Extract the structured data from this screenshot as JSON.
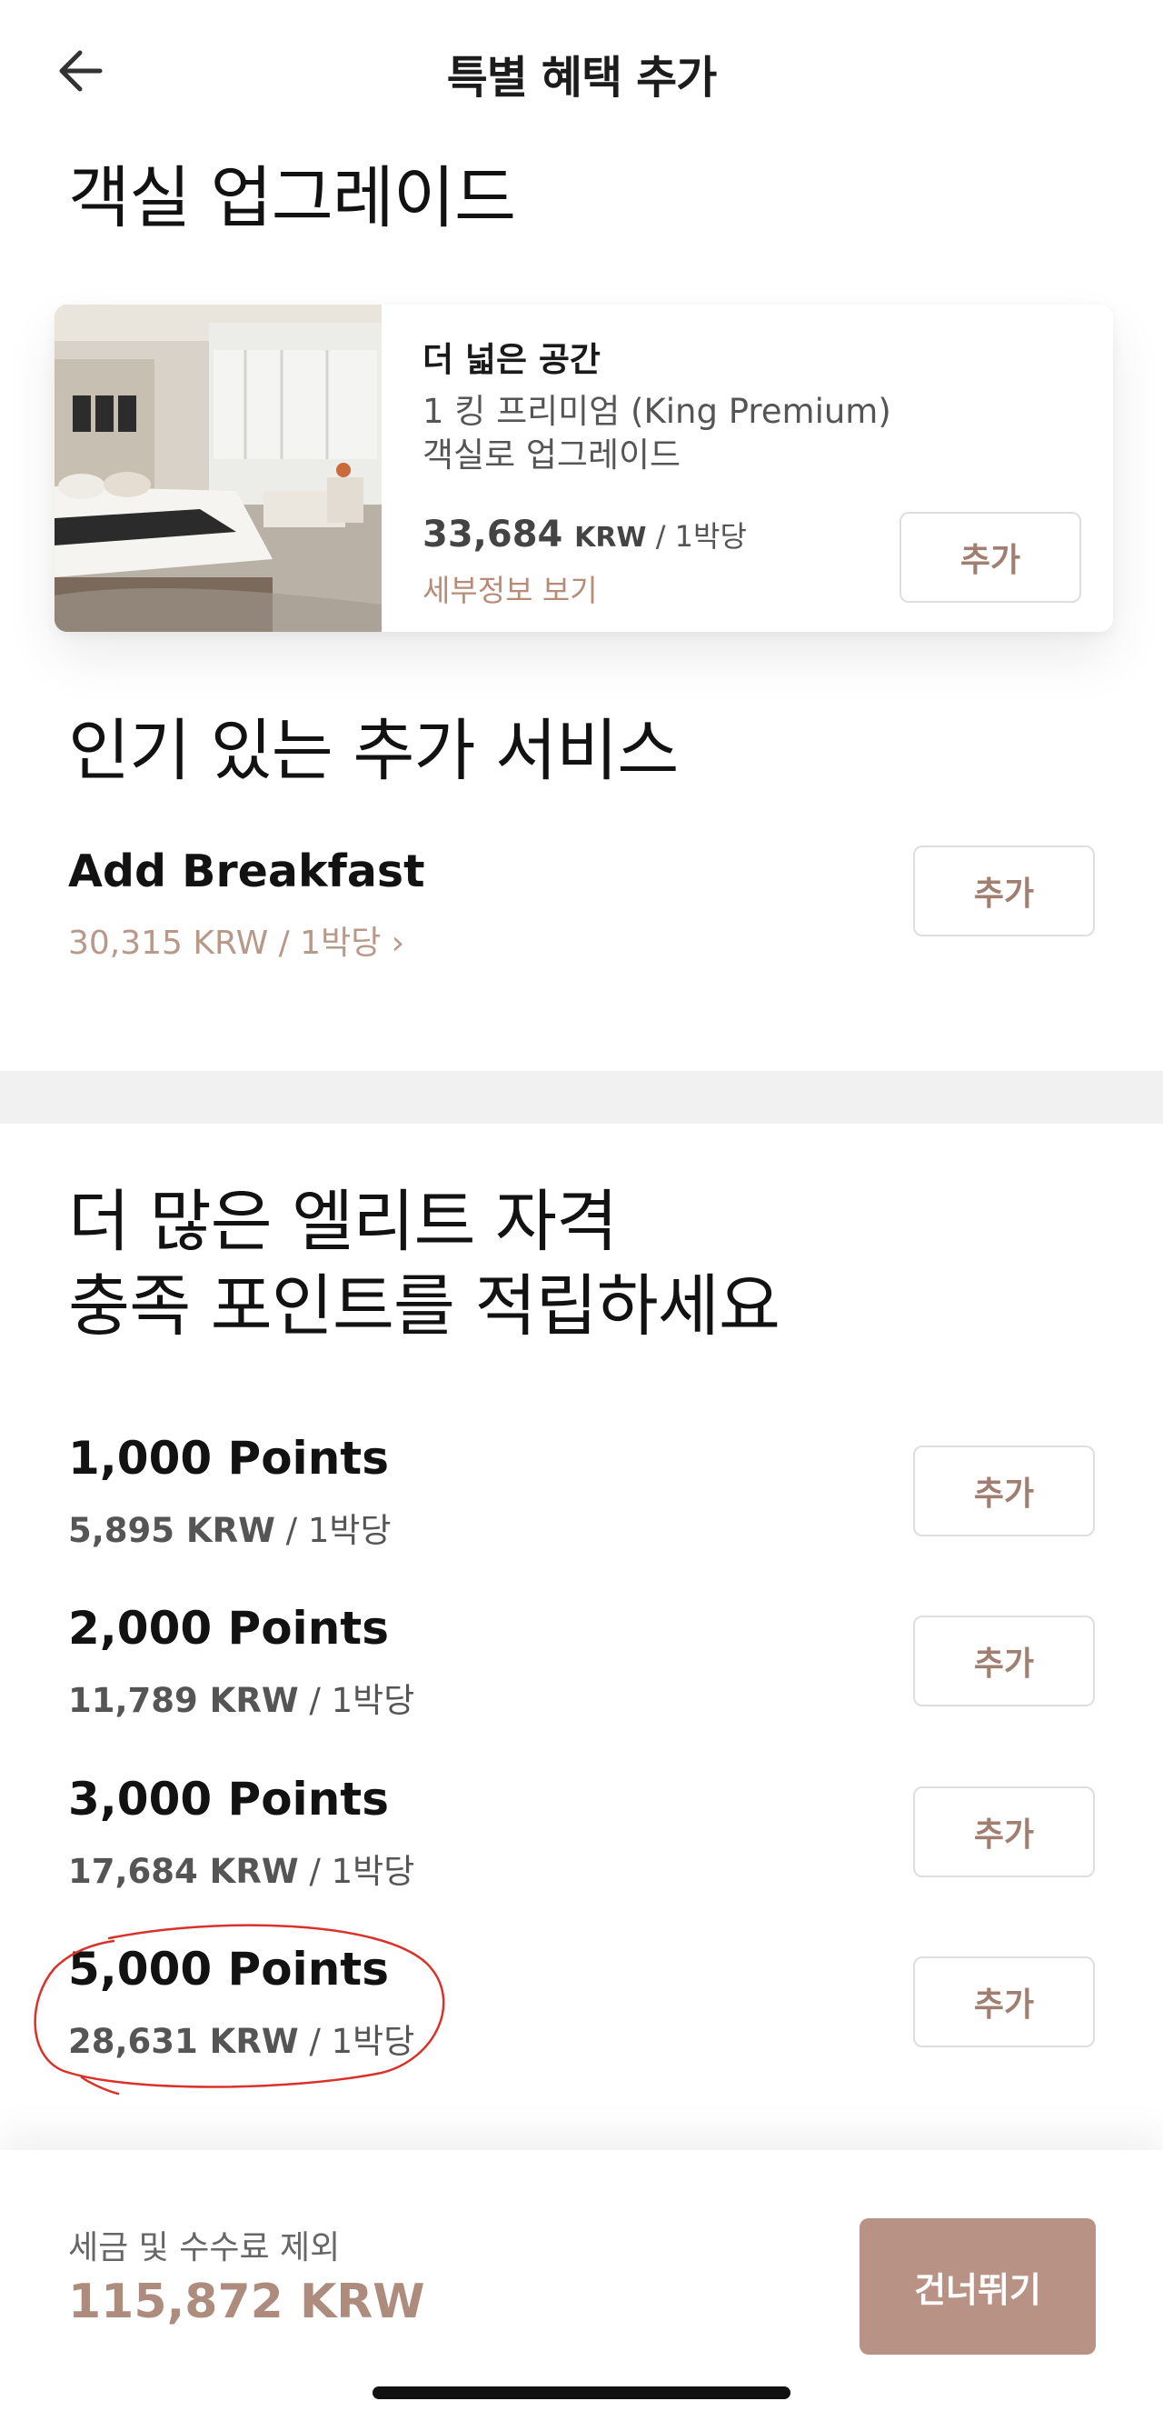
{
  "header": {
    "title": "특별 혜택 추가",
    "back_icon": "arrow-left-icon"
  },
  "room_upgrade": {
    "section_title": "객실 업그레이드",
    "card": {
      "title": "더 넓은 공간",
      "subtitle": "1 킹 프리미엄 (King Premium) 객실로 업그레이드",
      "price": "33,684",
      "currency": "KRW",
      "per": " / 1박당",
      "details_link": "세부정보 보기",
      "add_label": "추가"
    }
  },
  "popular_services": {
    "section_title": "인기 있는 추가 서비스",
    "items": [
      {
        "name": "Add Breakfast",
        "price": "30,315 KRW / 1박당 ›",
        "add_label": "추가"
      }
    ]
  },
  "elite_points": {
    "section_title_line1": "더 많은 엘리트 자격",
    "section_title_line2": "충족 포인트를 적립하세요",
    "items": [
      {
        "name": "1,000 Points",
        "price": "5,895 KRW",
        "per": " / 1박당",
        "add_label": "추가"
      },
      {
        "name": "2,000 Points",
        "price": "11,789 KRW",
        "per": " / 1박당",
        "add_label": "추가"
      },
      {
        "name": "3,000 Points",
        "price": "17,684 KRW",
        "per": " / 1박당",
        "add_label": "추가"
      },
      {
        "name": "5,000 Points",
        "price": "28,631 KRW",
        "per": " / 1박당",
        "add_label": "추가"
      }
    ]
  },
  "footer": {
    "note": "세금 및 수수료 제외",
    "total": "115,872 KRW",
    "skip_label": "건너뛰기"
  },
  "colors": {
    "accent": "#b89385",
    "link": "#b88b77",
    "annotation": "#d9322a"
  }
}
